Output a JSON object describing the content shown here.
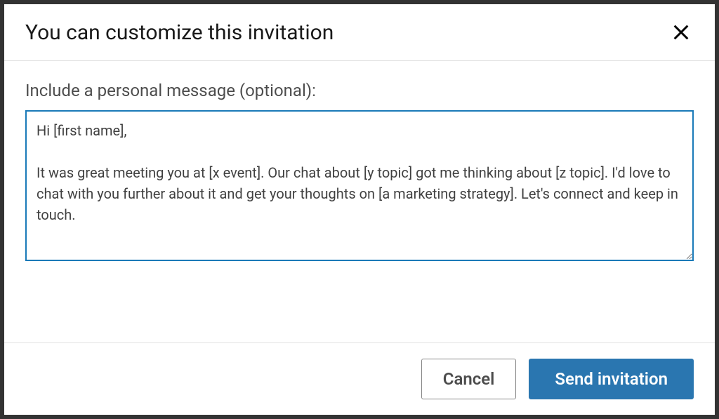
{
  "modal": {
    "title": "You can customize this invitation",
    "field_label": "Include a personal message (optional):",
    "message_value": "Hi [first name],\n\nIt was great meeting you at [x event]. Our chat about [y topic] got me thinking about [z topic]. I'd love to chat with you further about it and get your thoughts on [a marketing strategy]. Let's connect and keep in touch.",
    "cancel_label": "Cancel",
    "send_label": "Send invitation"
  }
}
